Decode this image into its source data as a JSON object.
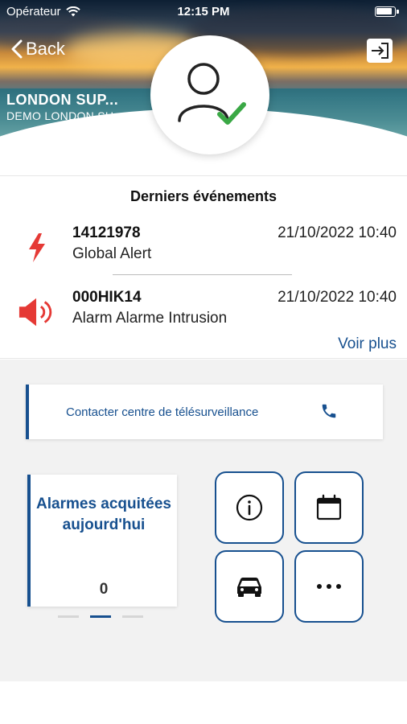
{
  "status_bar": {
    "carrier": "Opérateur",
    "time": "12:15 PM"
  },
  "header": {
    "back_label": "Back",
    "site_name": "LONDON SUP...",
    "site_subtitle": "DEMO LONDON SU",
    "avatar_status": "verified"
  },
  "events": {
    "title": "Derniers événements",
    "items": [
      {
        "code": "14121978",
        "description": "Global Alert",
        "datetime": "21/10/2022 10:40",
        "icon": "lightning-icon"
      },
      {
        "code": "000HIK14",
        "description": "Alarm Alarme Intrusion",
        "datetime": "21/10/2022 10:40",
        "icon": "speaker-alarm-icon"
      }
    ],
    "more_label": "Voir plus"
  },
  "contact": {
    "label": "Contacter centre de télésurveillance",
    "icon": "phone-icon"
  },
  "stats": {
    "label": "Alarmes acquitées aujourd'hui",
    "value": "0",
    "page_index": 1,
    "page_count": 3
  },
  "actions": [
    {
      "icon": "info-icon"
    },
    {
      "icon": "calendar-icon"
    },
    {
      "icon": "car-icon"
    },
    {
      "icon": "more-icon"
    }
  ],
  "colors": {
    "brand_blue": "#17508f",
    "alert_red": "#e53935",
    "check_green": "#3aa845"
  }
}
